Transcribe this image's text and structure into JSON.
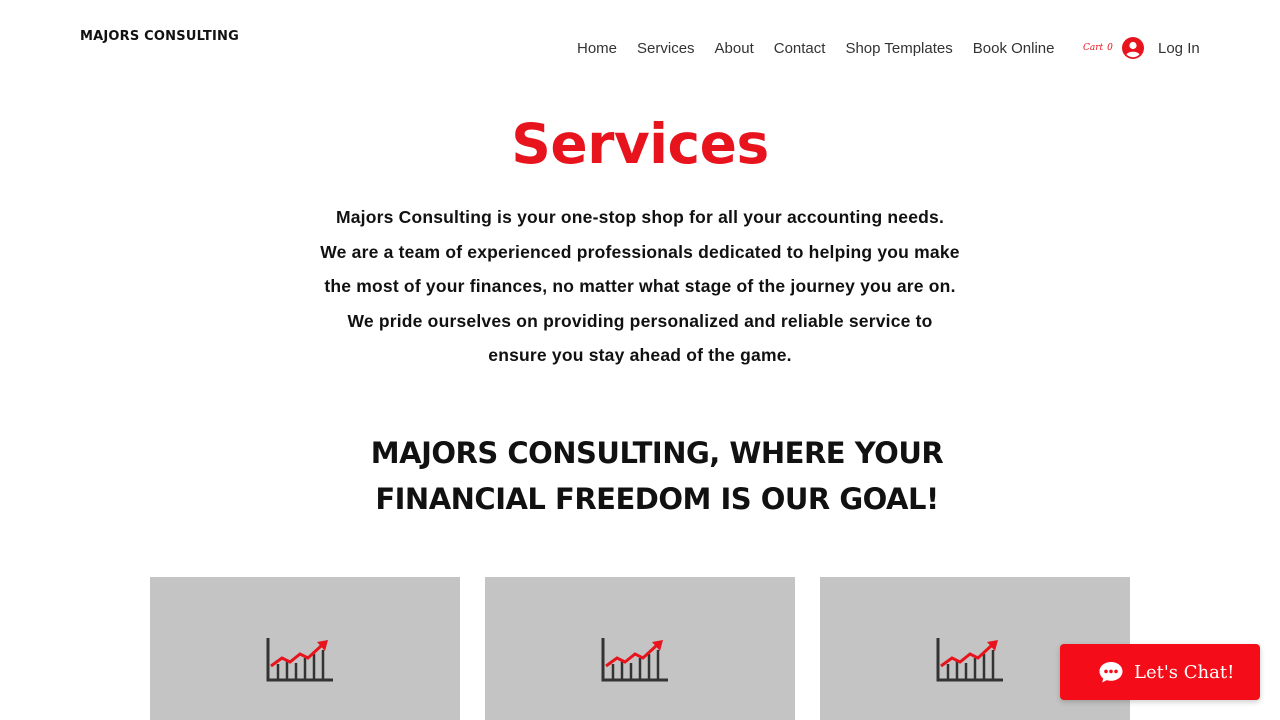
{
  "header": {
    "brand": "MAJORS CONSULTING",
    "nav": [
      "Home",
      "Services",
      "About",
      "Contact",
      "Shop Templates",
      "Book Online"
    ],
    "cart": {
      "label": "Cart",
      "count": "0"
    },
    "login_label": "Log In"
  },
  "main": {
    "title": "Services",
    "intro_lines": [
      "Majors Consulting is your one-stop shop for all your accounting needs.",
      "We are a team of experienced professionals dedicated to helping you make",
      "the most of your finances, no matter what stage of the journey you are on.",
      "We pride ourselves on providing personalized and reliable service to",
      "ensure you stay ahead of the game."
    ],
    "tagline_lines": [
      "MAJORS CONSULTING, WHERE YOUR",
      "FINANCIAL FREEDOM IS OUR GOAL!"
    ],
    "cards": [
      {
        "icon": "growth-chart-icon"
      },
      {
        "icon": "growth-chart-icon"
      },
      {
        "icon": "growth-chart-icon"
      }
    ]
  },
  "chat": {
    "label": "Let's Chat!",
    "icon": "chat-bubble-icon"
  },
  "colors": {
    "accent": "#e8141d",
    "card_bg": "#c4c4c4",
    "text": "#111111"
  }
}
